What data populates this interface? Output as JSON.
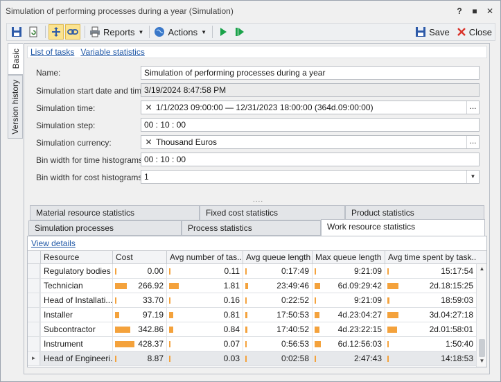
{
  "window": {
    "title": "Simulation of performing processes during a year (Simulation)",
    "help": "?",
    "restore": "■",
    "close": "✕"
  },
  "toolbar": {
    "reports_label": "Reports",
    "actions_label": "Actions",
    "save_label": "Save",
    "close_label": "Close"
  },
  "side_tabs": {
    "basic": "Basic",
    "version_history": "Version history"
  },
  "links": {
    "list_of_tasks": "List of tasks",
    "variable_statistics": "Variable statistics"
  },
  "form": {
    "name_label": "Name:",
    "name_value": "Simulation of performing processes during a year",
    "start_label": "Simulation start date and time:",
    "start_value": "3/19/2024 8:47:58 PM",
    "time_label": "Simulation time:",
    "time_value": "1/1/2023 09:00:00 — 12/31/2023 18:00:00 (364d.09:00:00)",
    "step_label": "Simulation step:",
    "step_value": "00 : 10 : 00",
    "currency_label": "Simulation currency:",
    "currency_value": "Thousand Euros",
    "bin_time_label": "Bin width for time histograms:",
    "bin_time_value": "00 : 10 : 00",
    "bin_cost_label": "Bin width for cost histograms:",
    "bin_cost_value": "1",
    "clear_glyph": "✕",
    "ellipsis_glyph": "...",
    "dropdown_glyph": "▼"
  },
  "splitter": "....",
  "stat_tabs": {
    "material_resource": "Material resource statistics",
    "fixed_cost": "Fixed cost statistics",
    "product": "Product statistics",
    "simulation_processes": "Simulation processes",
    "process": "Process statistics",
    "work_resource": "Work resource statistics"
  },
  "grid": {
    "view_details": "View details",
    "columns": [
      "Resource",
      "Cost",
      "Avg number of tas...",
      "Avg queue length",
      "Max queue length",
      "Avg time spent by task..."
    ],
    "rows": [
      {
        "resource": "Regulatory bodies",
        "cost": "0.00",
        "cost_level": 0.0,
        "avg_num": "0.11",
        "avg_num_level": 0.05,
        "avg_queue": "0:17:49",
        "avg_queue_level": 0.0,
        "max_queue": "9:21:09",
        "max_queue_level": 0.0,
        "avg_time": "15:17:54",
        "avg_time_level": 0.1
      },
      {
        "resource": "Technician",
        "cost": "266.92",
        "cost_level": 0.62,
        "avg_num": "1.81",
        "avg_num_level": 1.0,
        "avg_queue": "23:49:46",
        "avg_queue_level": 0.15,
        "max_queue": "6d.09:29:42",
        "max_queue_level": 0.6,
        "avg_time": "2d.18:15:25",
        "avg_time_level": 1.0
      },
      {
        "resource": "Head of Installati...",
        "cost": "33.70",
        "cost_level": 0.08,
        "avg_num": "0.16",
        "avg_num_level": 0.08,
        "avg_queue": "0:22:52",
        "avg_queue_level": 0.0,
        "max_queue": "9:21:09",
        "max_queue_level": 0.05,
        "avg_time": "18:59:03",
        "avg_time_level": 0.2
      },
      {
        "resource": "Installer",
        "cost": "97.19",
        "cost_level": 0.23,
        "avg_num": "0.81",
        "avg_num_level": 0.45,
        "avg_queue": "17:50:53",
        "avg_queue_level": 0.12,
        "max_queue": "4d.23:04:27",
        "max_queue_level": 0.5,
        "avg_time": "3d.04:27:18",
        "avg_time_level": 1.0
      },
      {
        "resource": "Subcontractor",
        "cost": "342.86",
        "cost_level": 0.8,
        "avg_num": "0.84",
        "avg_num_level": 0.45,
        "avg_queue": "17:40:52",
        "avg_queue_level": 0.12,
        "max_queue": "4d.23:22:15",
        "max_queue_level": 0.5,
        "avg_time": "2d.01:58:01",
        "avg_time_level": 0.9
      },
      {
        "resource": "Instrument",
        "cost": "428.37",
        "cost_level": 1.0,
        "avg_num": "0.07",
        "avg_num_level": 0.04,
        "avg_queue": "0:56:53",
        "avg_queue_level": 0.0,
        "max_queue": "6d.12:56:03",
        "max_queue_level": 0.65,
        "avg_time": "1:50:40",
        "avg_time_level": 0.0
      },
      {
        "resource": "Head of Engineeri...",
        "cost": "8.87",
        "cost_level": 0.0,
        "avg_num": "0.03",
        "avg_num_level": 0.0,
        "avg_queue": "0:02:58",
        "avg_queue_level": 0.0,
        "max_queue": "2:47:43",
        "max_queue_level": 0.0,
        "avg_time": "14:18:53",
        "avg_time_level": 0.0
      }
    ],
    "row_indicator": "►",
    "scroll_up": "▲",
    "scroll_down": "▼"
  },
  "colors": {
    "bar": "#f4a23c",
    "link": "#1f57a6",
    "play": "#1aa34a",
    "accent": "#fbe38f"
  }
}
